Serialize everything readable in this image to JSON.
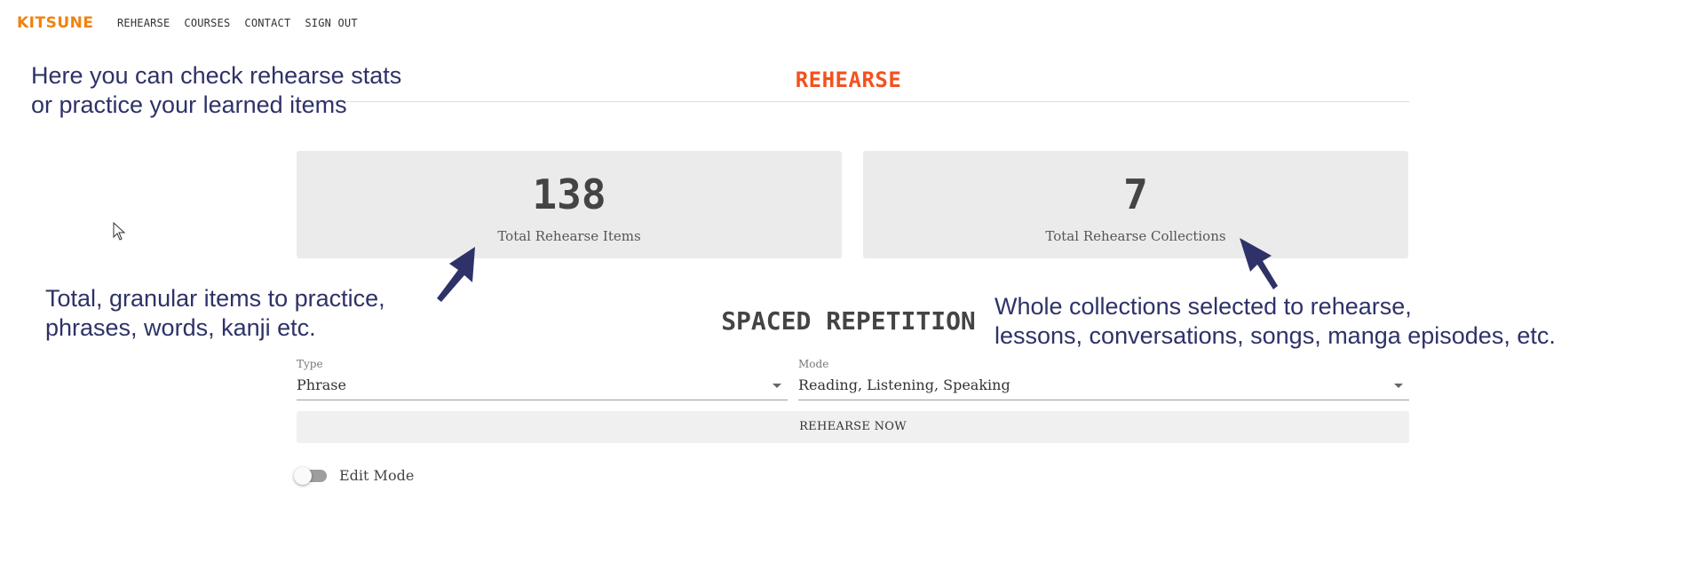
{
  "nav": {
    "logo": "KITSUNE",
    "links": [
      "REHEARSE",
      "COURSES",
      "CONTACT",
      "SIGN OUT"
    ]
  },
  "page_title": "REHEARSE",
  "stats": {
    "items": {
      "value": "138",
      "label": "Total Rehearse Items"
    },
    "collections": {
      "value": "7",
      "label": "Total Rehearse Collections"
    }
  },
  "spaced_repetition": {
    "title": "SPACED REPETITION",
    "type": {
      "label": "Type",
      "value": "Phrase"
    },
    "mode": {
      "label": "Mode",
      "value": "Reading, Listening, Speaking"
    },
    "button_label": "REHEARSE NOW",
    "edit_mode_label": "Edit Mode",
    "edit_mode_on": false
  },
  "annotations": {
    "intro": [
      "Here you can check rehearse stats",
      "or practice your learned items"
    ],
    "items": [
      "Total, granular items to practice,",
      "phrases, words, kanji etc."
    ],
    "collections": [
      "Whole collections selected to rehearse,",
      "lessons, conversations, songs, manga episodes, etc."
    ]
  },
  "colors": {
    "logo": "#f0820f",
    "page_title": "#f4511e",
    "annotation": "#2e3268",
    "card_bg": "#ebebeb"
  }
}
